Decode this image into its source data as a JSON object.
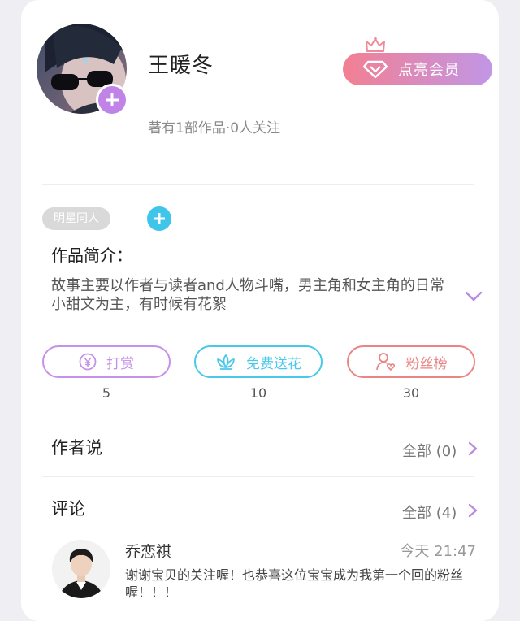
{
  "profile": {
    "name": "王暖冬",
    "stats": "著有1部作品·0人关注",
    "vip_button": "点亮会员"
  },
  "tags": {
    "first": "明星同人"
  },
  "intro": {
    "title": "作品简介：",
    "text": "故事主要以作者与读者and人物斗嘴，男主角和女主角的日常小甜文为主，有时候有花絮"
  },
  "actions": [
    {
      "label": "打赏",
      "count": "5",
      "color": "#c691e8",
      "icon": "yen-coin-icon"
    },
    {
      "label": "免费送花",
      "count": "10",
      "color": "#49c8ea",
      "icon": "lotus-flower-icon"
    },
    {
      "label": "粉丝榜",
      "count": "30",
      "color": "#ea8585",
      "icon": "fan-user-icon"
    }
  ],
  "author_says": {
    "title": "作者说",
    "link": "全部 (0)"
  },
  "comments": {
    "title": "评论",
    "link": "全部 (4)",
    "items": [
      {
        "name": "乔恋祺",
        "time": "今天 21:47",
        "text": "谢谢宝贝的关注喔！也恭喜这位宝宝成为我第一个回的粉丝喔！！！"
      }
    ]
  },
  "colors": {
    "accent": "#c084e8",
    "chevron": "#b98be0",
    "vip_start": "#f37f92",
    "vip_end": "#c196e6"
  }
}
